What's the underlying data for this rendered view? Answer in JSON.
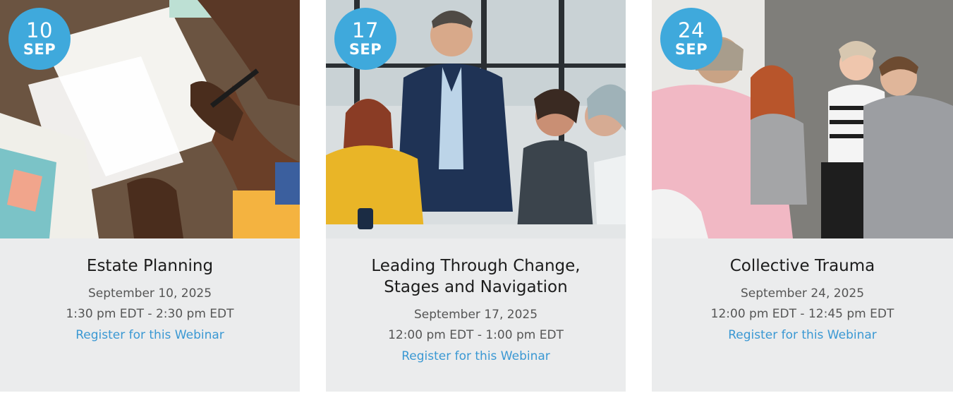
{
  "events": [
    {
      "day": "10",
      "month": "SEP",
      "title": "Estate Planning",
      "date": "September 10, 2025",
      "time": "1:30 pm EDT - 2:30 pm EDT",
      "link_label": "Register for this Webinar"
    },
    {
      "day": "17",
      "month": "SEP",
      "title": "Leading Through Change, Stages and Navigation",
      "date": "September 17, 2025",
      "time": "12:00 pm EDT - 1:00 pm EDT",
      "link_label": "Register for this Webinar"
    },
    {
      "day": "24",
      "month": "SEP",
      "title": "Collective Trauma",
      "date": "September 24, 2025",
      "time": "12:00 pm EDT - 12:45 pm EDT",
      "link_label": "Register for this Webinar"
    }
  ],
  "colors": {
    "badge": "#3fa9dc",
    "card_background": "#ebeced",
    "link": "#3a98d3"
  }
}
